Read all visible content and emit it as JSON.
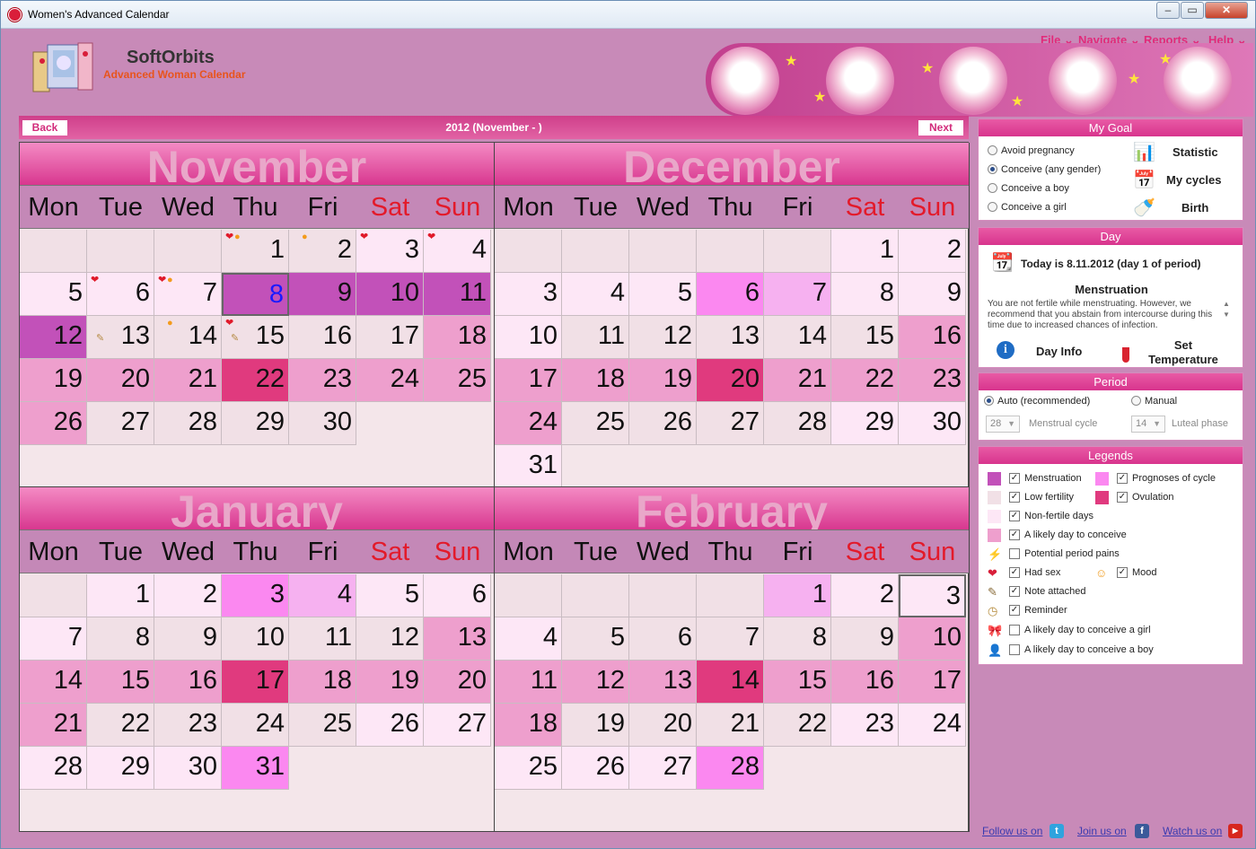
{
  "window": {
    "title": "Women's Advanced Calendar"
  },
  "brand": {
    "name": "SoftOrbits",
    "subtitle": "Advanced Woman Calendar"
  },
  "menu": {
    "file": "File",
    "navigate": "Navigate",
    "reports": "Reports",
    "help": "Help"
  },
  "nav": {
    "back": "Back",
    "next": "Next",
    "title": "2012 (November - )"
  },
  "weekdays": [
    "Mon",
    "Tue",
    "Wed",
    "Thu",
    "Fri",
    "Sat",
    "Sun"
  ],
  "months": [
    {
      "name": "November",
      "cells": [
        {
          "col": 0,
          "row": 0,
          "d": "",
          "t": "low"
        },
        {
          "col": 1,
          "row": 0,
          "d": "",
          "t": "low"
        },
        {
          "col": 2,
          "row": 0,
          "d": "",
          "t": "low"
        },
        {
          "col": 3,
          "row": 0,
          "d": "1",
          "t": "low",
          "mk": "heart",
          "mk2": "mood"
        },
        {
          "col": 4,
          "row": 0,
          "d": "2",
          "t": "low",
          "mk2": "mood"
        },
        {
          "col": 5,
          "row": 0,
          "d": "3",
          "t": "non",
          "mk": "heart"
        },
        {
          "col": 6,
          "row": 0,
          "d": "4",
          "t": "non",
          "mk": "heart"
        },
        {
          "col": 0,
          "row": 1,
          "d": "5",
          "t": "non"
        },
        {
          "col": 1,
          "row": 1,
          "d": "6",
          "t": "non",
          "mk": "heart"
        },
        {
          "col": 2,
          "row": 1,
          "d": "7",
          "t": "non",
          "mk": "heart",
          "mk2": "mood"
        },
        {
          "col": 3,
          "row": 1,
          "d": "8",
          "t": "m",
          "sel": true
        },
        {
          "col": 4,
          "row": 1,
          "d": "9",
          "t": "m"
        },
        {
          "col": 5,
          "row": 1,
          "d": "10",
          "t": "m"
        },
        {
          "col": 6,
          "row": 1,
          "d": "11",
          "t": "m"
        },
        {
          "col": 0,
          "row": 2,
          "d": "12",
          "t": "m"
        },
        {
          "col": 1,
          "row": 2,
          "d": "13",
          "t": "low",
          "note": true
        },
        {
          "col": 2,
          "row": 2,
          "d": "14",
          "t": "low",
          "mk2": "mood"
        },
        {
          "col": 3,
          "row": 2,
          "d": "15",
          "t": "low",
          "mk": "heart",
          "note": true
        },
        {
          "col": 4,
          "row": 2,
          "d": "16",
          "t": "low"
        },
        {
          "col": 5,
          "row": 2,
          "d": "17",
          "t": "low"
        },
        {
          "col": 6,
          "row": 2,
          "d": "18",
          "t": "lik"
        },
        {
          "col": 0,
          "row": 3,
          "d": "19",
          "t": "lik"
        },
        {
          "col": 1,
          "row": 3,
          "d": "20",
          "t": "lik"
        },
        {
          "col": 2,
          "row": 3,
          "d": "21",
          "t": "lik"
        },
        {
          "col": 3,
          "row": 3,
          "d": "22",
          "t": "ov"
        },
        {
          "col": 4,
          "row": 3,
          "d": "23",
          "t": "lik"
        },
        {
          "col": 5,
          "row": 3,
          "d": "24",
          "t": "lik"
        },
        {
          "col": 6,
          "row": 3,
          "d": "25",
          "t": "lik"
        },
        {
          "col": 0,
          "row": 4,
          "d": "26",
          "t": "lik"
        },
        {
          "col": 1,
          "row": 4,
          "d": "27",
          "t": "low"
        },
        {
          "col": 2,
          "row": 4,
          "d": "28",
          "t": "low"
        },
        {
          "col": 3,
          "row": 4,
          "d": "29",
          "t": "low"
        },
        {
          "col": 4,
          "row": 4,
          "d": "30",
          "t": "low"
        }
      ]
    },
    {
      "name": "December",
      "cells": [
        {
          "col": 0,
          "row": 0,
          "d": "",
          "t": "low"
        },
        {
          "col": 1,
          "row": 0,
          "d": "",
          "t": "low"
        },
        {
          "col": 2,
          "row": 0,
          "d": "",
          "t": "low"
        },
        {
          "col": 3,
          "row": 0,
          "d": "",
          "t": "low"
        },
        {
          "col": 4,
          "row": 0,
          "d": "",
          "t": "low"
        },
        {
          "col": 5,
          "row": 0,
          "d": "1",
          "t": "non"
        },
        {
          "col": 6,
          "row": 0,
          "d": "2",
          "t": "non"
        },
        {
          "col": 0,
          "row": 1,
          "d": "3",
          "t": "non"
        },
        {
          "col": 1,
          "row": 1,
          "d": "4",
          "t": "non"
        },
        {
          "col": 2,
          "row": 1,
          "d": "5",
          "t": "non"
        },
        {
          "col": 3,
          "row": 1,
          "d": "6",
          "t": "pro"
        },
        {
          "col": 4,
          "row": 1,
          "d": "7",
          "t": "pro2"
        },
        {
          "col": 5,
          "row": 1,
          "d": "8",
          "t": "non"
        },
        {
          "col": 6,
          "row": 1,
          "d": "9",
          "t": "non"
        },
        {
          "col": 0,
          "row": 2,
          "d": "10",
          "t": "non"
        },
        {
          "col": 1,
          "row": 2,
          "d": "11",
          "t": "low"
        },
        {
          "col": 2,
          "row": 2,
          "d": "12",
          "t": "low"
        },
        {
          "col": 3,
          "row": 2,
          "d": "13",
          "t": "low"
        },
        {
          "col": 4,
          "row": 2,
          "d": "14",
          "t": "low"
        },
        {
          "col": 5,
          "row": 2,
          "d": "15",
          "t": "low"
        },
        {
          "col": 6,
          "row": 2,
          "d": "16",
          "t": "lik"
        },
        {
          "col": 0,
          "row": 3,
          "d": "17",
          "t": "lik"
        },
        {
          "col": 1,
          "row": 3,
          "d": "18",
          "t": "lik"
        },
        {
          "col": 2,
          "row": 3,
          "d": "19",
          "t": "lik"
        },
        {
          "col": 3,
          "row": 3,
          "d": "20",
          "t": "ov"
        },
        {
          "col": 4,
          "row": 3,
          "d": "21",
          "t": "lik"
        },
        {
          "col": 5,
          "row": 3,
          "d": "22",
          "t": "lik"
        },
        {
          "col": 6,
          "row": 3,
          "d": "23",
          "t": "lik"
        },
        {
          "col": 0,
          "row": 4,
          "d": "24",
          "t": "lik"
        },
        {
          "col": 1,
          "row": 4,
          "d": "25",
          "t": "low"
        },
        {
          "col": 2,
          "row": 4,
          "d": "26",
          "t": "low"
        },
        {
          "col": 3,
          "row": 4,
          "d": "27",
          "t": "low"
        },
        {
          "col": 4,
          "row": 4,
          "d": "28",
          "t": "low"
        },
        {
          "col": 5,
          "row": 4,
          "d": "29",
          "t": "non"
        },
        {
          "col": 6,
          "row": 4,
          "d": "30",
          "t": "non"
        },
        {
          "col": 0,
          "row": 5,
          "d": "31",
          "t": "non"
        }
      ]
    },
    {
      "name": "January",
      "cells": [
        {
          "col": 0,
          "row": 0,
          "d": "",
          "t": "low"
        },
        {
          "col": 1,
          "row": 0,
          "d": "1",
          "t": "non"
        },
        {
          "col": 2,
          "row": 0,
          "d": "2",
          "t": "non"
        },
        {
          "col": 3,
          "row": 0,
          "d": "3",
          "t": "pro"
        },
        {
          "col": 4,
          "row": 0,
          "d": "4",
          "t": "pro2"
        },
        {
          "col": 5,
          "row": 0,
          "d": "5",
          "t": "non"
        },
        {
          "col": 6,
          "row": 0,
          "d": "6",
          "t": "non"
        },
        {
          "col": 0,
          "row": 1,
          "d": "7",
          "t": "non"
        },
        {
          "col": 1,
          "row": 1,
          "d": "8",
          "t": "low"
        },
        {
          "col": 2,
          "row": 1,
          "d": "9",
          "t": "low"
        },
        {
          "col": 3,
          "row": 1,
          "d": "10",
          "t": "low"
        },
        {
          "col": 4,
          "row": 1,
          "d": "11",
          "t": "low"
        },
        {
          "col": 5,
          "row": 1,
          "d": "12",
          "t": "low"
        },
        {
          "col": 6,
          "row": 1,
          "d": "13",
          "t": "lik"
        },
        {
          "col": 0,
          "row": 2,
          "d": "14",
          "t": "lik"
        },
        {
          "col": 1,
          "row": 2,
          "d": "15",
          "t": "lik"
        },
        {
          "col": 2,
          "row": 2,
          "d": "16",
          "t": "lik"
        },
        {
          "col": 3,
          "row": 2,
          "d": "17",
          "t": "ov"
        },
        {
          "col": 4,
          "row": 2,
          "d": "18",
          "t": "lik"
        },
        {
          "col": 5,
          "row": 2,
          "d": "19",
          "t": "lik"
        },
        {
          "col": 6,
          "row": 2,
          "d": "20",
          "t": "lik"
        },
        {
          "col": 0,
          "row": 3,
          "d": "21",
          "t": "lik"
        },
        {
          "col": 1,
          "row": 3,
          "d": "22",
          "t": "low"
        },
        {
          "col": 2,
          "row": 3,
          "d": "23",
          "t": "low"
        },
        {
          "col": 3,
          "row": 3,
          "d": "24",
          "t": "low"
        },
        {
          "col": 4,
          "row": 3,
          "d": "25",
          "t": "low"
        },
        {
          "col": 5,
          "row": 3,
          "d": "26",
          "t": "non"
        },
        {
          "col": 6,
          "row": 3,
          "d": "27",
          "t": "non"
        },
        {
          "col": 0,
          "row": 4,
          "d": "28",
          "t": "non"
        },
        {
          "col": 1,
          "row": 4,
          "d": "29",
          "t": "non"
        },
        {
          "col": 2,
          "row": 4,
          "d": "30",
          "t": "non"
        },
        {
          "col": 3,
          "row": 4,
          "d": "31",
          "t": "pro"
        }
      ]
    },
    {
      "name": "February",
      "cells": [
        {
          "col": 0,
          "row": 0,
          "d": "",
          "t": "low"
        },
        {
          "col": 1,
          "row": 0,
          "d": "",
          "t": "low"
        },
        {
          "col": 2,
          "row": 0,
          "d": "",
          "t": "low"
        },
        {
          "col": 3,
          "row": 0,
          "d": "",
          "t": "low"
        },
        {
          "col": 4,
          "row": 0,
          "d": "1",
          "t": "pro2"
        },
        {
          "col": 5,
          "row": 0,
          "d": "2",
          "t": "non"
        },
        {
          "col": 6,
          "row": 0,
          "d": "3",
          "t": "non",
          "sel": true
        },
        {
          "col": 0,
          "row": 1,
          "d": "4",
          "t": "non"
        },
        {
          "col": 1,
          "row": 1,
          "d": "5",
          "t": "low"
        },
        {
          "col": 2,
          "row": 1,
          "d": "6",
          "t": "low"
        },
        {
          "col": 3,
          "row": 1,
          "d": "7",
          "t": "low"
        },
        {
          "col": 4,
          "row": 1,
          "d": "8",
          "t": "low"
        },
        {
          "col": 5,
          "row": 1,
          "d": "9",
          "t": "low"
        },
        {
          "col": 6,
          "row": 1,
          "d": "10",
          "t": "lik"
        },
        {
          "col": 0,
          "row": 2,
          "d": "11",
          "t": "lik"
        },
        {
          "col": 1,
          "row": 2,
          "d": "12",
          "t": "lik"
        },
        {
          "col": 2,
          "row": 2,
          "d": "13",
          "t": "lik"
        },
        {
          "col": 3,
          "row": 2,
          "d": "14",
          "t": "ov"
        },
        {
          "col": 4,
          "row": 2,
          "d": "15",
          "t": "lik"
        },
        {
          "col": 5,
          "row": 2,
          "d": "16",
          "t": "lik"
        },
        {
          "col": 6,
          "row": 2,
          "d": "17",
          "t": "lik"
        },
        {
          "col": 0,
          "row": 3,
          "d": "18",
          "t": "lik"
        },
        {
          "col": 1,
          "row": 3,
          "d": "19",
          "t": "low"
        },
        {
          "col": 2,
          "row": 3,
          "d": "20",
          "t": "low"
        },
        {
          "col": 3,
          "row": 3,
          "d": "21",
          "t": "low"
        },
        {
          "col": 4,
          "row": 3,
          "d": "22",
          "t": "low"
        },
        {
          "col": 5,
          "row": 3,
          "d": "23",
          "t": "non"
        },
        {
          "col": 6,
          "row": 3,
          "d": "24",
          "t": "non"
        },
        {
          "col": 0,
          "row": 4,
          "d": "25",
          "t": "non"
        },
        {
          "col": 1,
          "row": 4,
          "d": "26",
          "t": "non"
        },
        {
          "col": 2,
          "row": 4,
          "d": "27",
          "t": "non"
        },
        {
          "col": 3,
          "row": 4,
          "d": "28",
          "t": "pro"
        }
      ]
    }
  ],
  "goal": {
    "title": "My Goal",
    "options": [
      "Avoid pregnancy",
      "Conceive (any gender)",
      "Conceive a boy",
      "Conceive a girl"
    ],
    "selected": 1,
    "statistic": "Statistic",
    "my_cycles": "My cycles",
    "birth": "Birth"
  },
  "day": {
    "title": "Day",
    "today": "Today is 8.11.2012 (day 1 of period)",
    "phase": "Menstruation",
    "text": "You are not fertile while menstruating. However, we recommend that you abstain from intercourse during this time due to increased chances of infection.",
    "info": "Day Info",
    "temperature_1": "Set",
    "temperature_2": "Temperature"
  },
  "period": {
    "title": "Period",
    "auto": "Auto (recommended)",
    "manual": "Manual",
    "cycle_value": "28",
    "cycle_label": "Menstrual cycle",
    "luteal_value": "14",
    "luteal_label": "Luteal phase"
  },
  "legends": {
    "title": "Legends",
    "items": [
      {
        "label": "Menstruation",
        "color": "#c251b9",
        "checked": true
      },
      {
        "label": "Prognoses of cycle",
        "color": "#fb88f0",
        "checked": true
      },
      {
        "label": "Low fertility",
        "color": "#f1e0e6",
        "checked": true
      },
      {
        "label": "Ovulation",
        "color": "#e03a7e",
        "checked": true
      },
      {
        "label": "Non-fertile days",
        "color": "#fde7f6",
        "checked": true
      },
      {
        "label": "A likely day to conceive",
        "color": "#ee9fcd",
        "checked": true
      },
      {
        "label": "Potential period pains",
        "icon": "lightning-icon",
        "checked": false
      },
      {
        "label": "Had sex",
        "icon": "heart-icon",
        "checked": true
      },
      {
        "label": "Mood",
        "icon": "smiley-icon",
        "checked": true
      },
      {
        "label": "Note attached",
        "icon": "note-icon",
        "checked": true
      },
      {
        "label": "Reminder",
        "icon": "clock-icon",
        "checked": true
      },
      {
        "label": "A likely day to conceive a girl",
        "icon": "girl-icon",
        "checked": false
      },
      {
        "label": "A likely day to conceive a boy",
        "icon": "boy-icon",
        "checked": false
      }
    ]
  },
  "footer": {
    "twitter": "Follow us on",
    "facebook": "Join us on",
    "youtube": "Watch us on"
  }
}
